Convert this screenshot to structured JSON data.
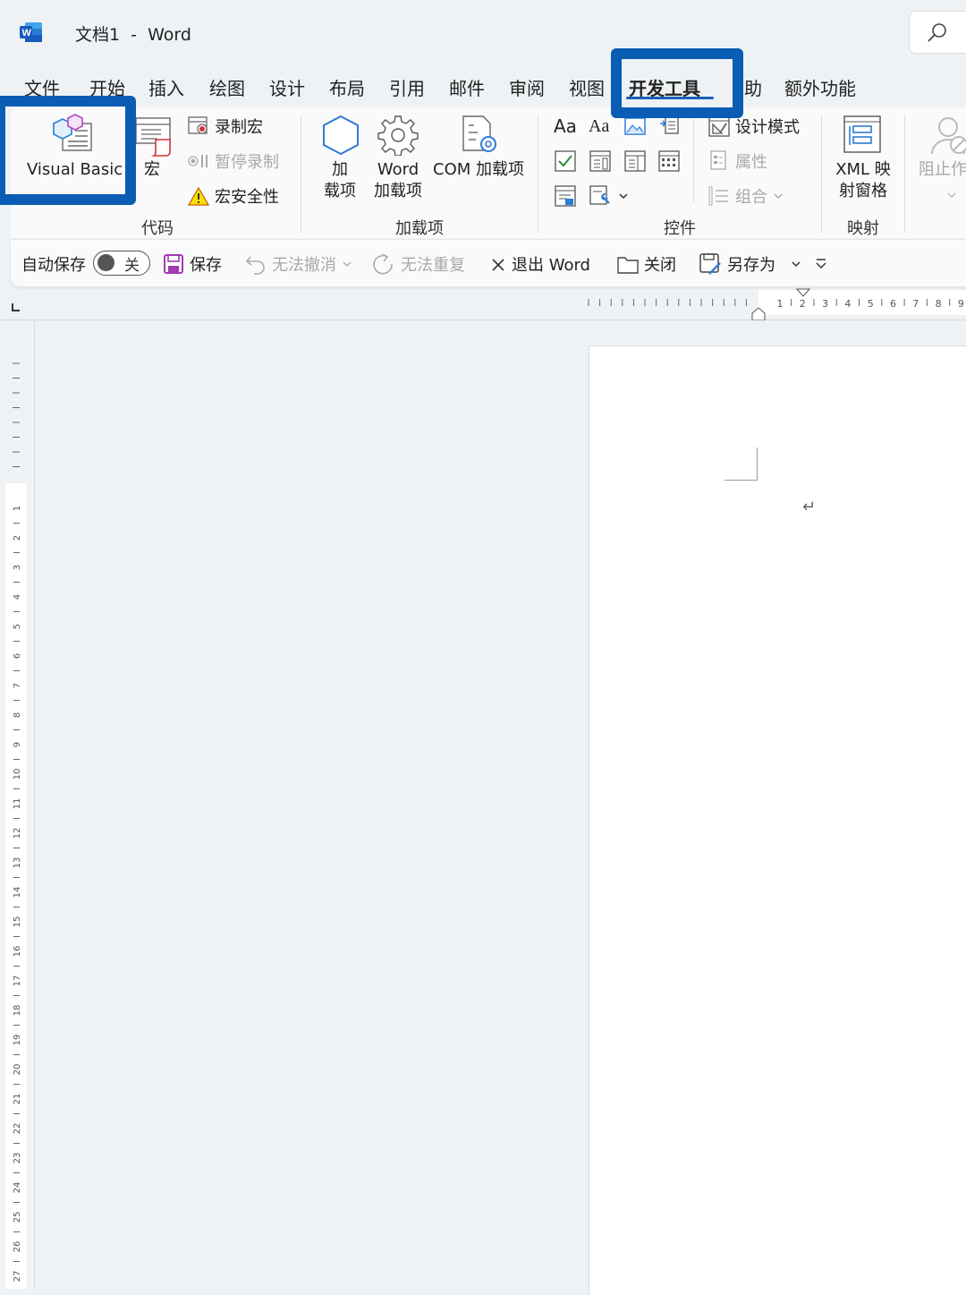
{
  "window": {
    "title": "文档1  -  Word"
  },
  "colors": {
    "accent": "#1a5fb4",
    "highlight": "#0a5db3",
    "word_blue": "#185abd"
  },
  "tabs": [
    {
      "label": "文件"
    },
    {
      "label": "开始"
    },
    {
      "label": "插入"
    },
    {
      "label": "绘图"
    },
    {
      "label": "设计"
    },
    {
      "label": "布局"
    },
    {
      "label": "引用"
    },
    {
      "label": "邮件"
    },
    {
      "label": "审阅"
    },
    {
      "label": "视图"
    },
    {
      "label": "开发工具",
      "active": true
    },
    {
      "label": "帮助",
      "partial": "助"
    },
    {
      "label": "额外功能"
    }
  ],
  "ribbon": {
    "code": {
      "group_label": "代码",
      "visual_basic": "Visual Basic",
      "macros": "宏",
      "record_macro": "录制宏",
      "pause_recording": "暂停录制",
      "macro_security": "宏安全性"
    },
    "addins": {
      "group_label": "加载项",
      "addins_line1": "加",
      "addins_line2": "载项",
      "word_addins_line1": "Word",
      "word_addins_line2": "加载项",
      "com_addins": "COM 加载项"
    },
    "controls": {
      "group_label": "控件",
      "design_mode": "设计模式",
      "properties": "属性",
      "group": "组合",
      "aa1": "Aa",
      "aa2": "Aa"
    },
    "mapping": {
      "group_label": "映射",
      "xml_line1": "XML 映",
      "xml_line2": "射窗格"
    },
    "protect": {
      "block_authors": "阻止作"
    }
  },
  "quick_access": {
    "autosave_label": "自动保存",
    "autosave_state": "关",
    "save": "保存",
    "undo": "无法撤消",
    "redo": "无法重复",
    "exit_word": "退出 Word",
    "close": "关闭",
    "save_as": "另存为"
  },
  "horizontal_ruler_numbers": [
    "1",
    "2",
    "3",
    "4",
    "5",
    "6",
    "7",
    "8",
    "9"
  ],
  "vertical_ruler_numbers": [
    "1",
    "2",
    "3",
    "4",
    "5",
    "6",
    "7",
    "8",
    "9",
    "10",
    "11",
    "12",
    "13",
    "14",
    "15",
    "16",
    "17",
    "18",
    "19",
    "20",
    "21",
    "22",
    "23",
    "24",
    "25",
    "26",
    "27"
  ],
  "document": {
    "paragraph_mark": "↵"
  }
}
